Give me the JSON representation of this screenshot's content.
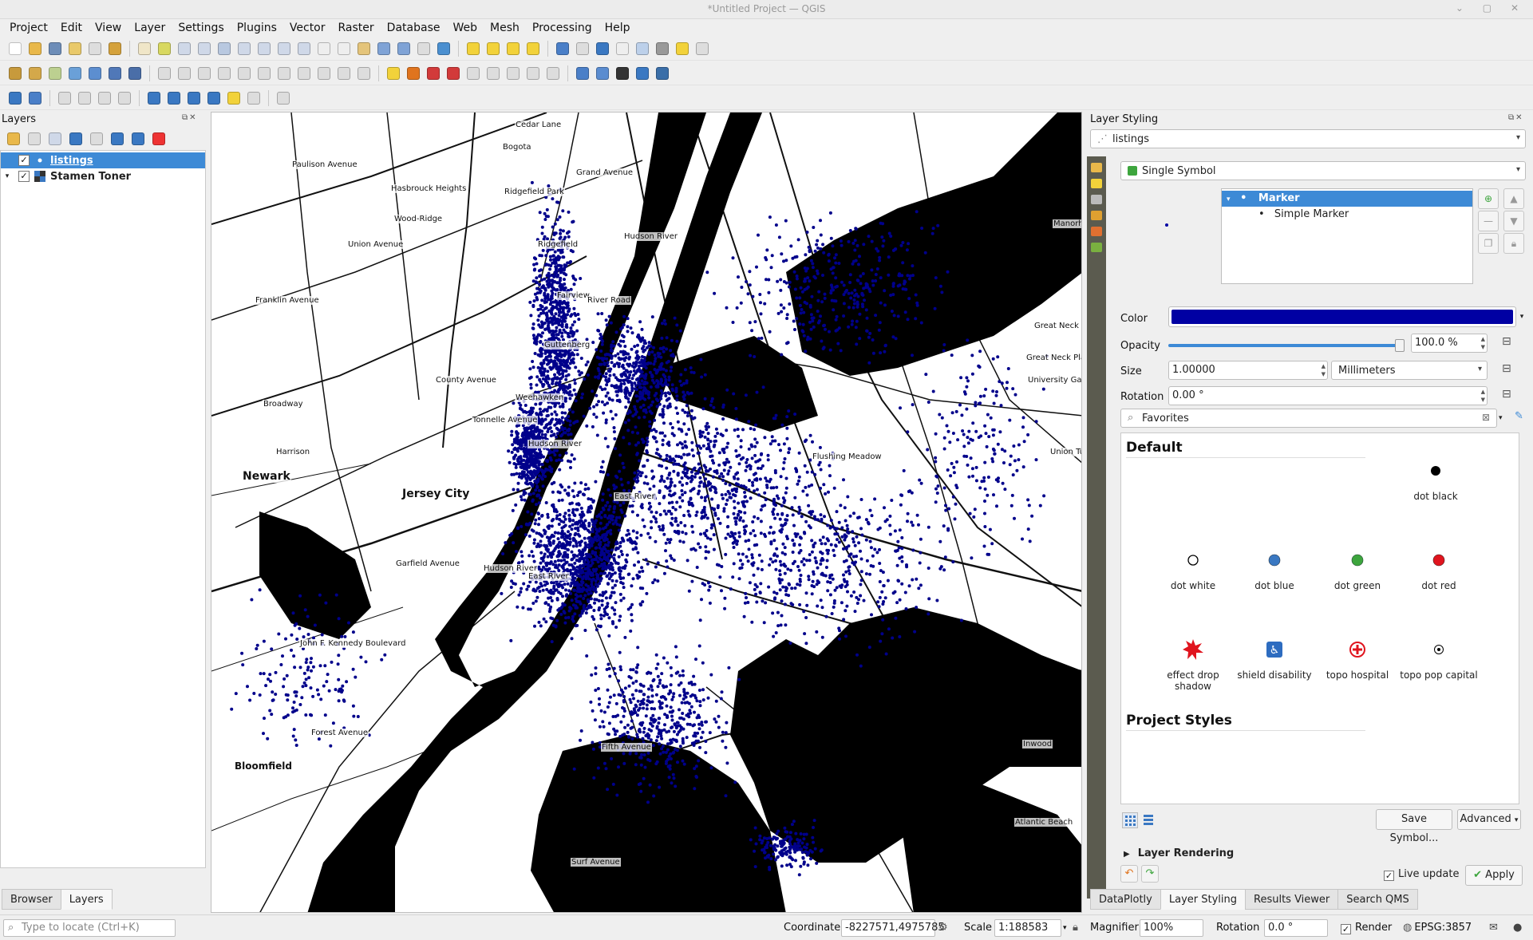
{
  "window": {
    "title": "*Untitled Project — QGIS",
    "controls": "⌄ ▢ ✕"
  },
  "menu": [
    "Project",
    "Edit",
    "View",
    "Layer",
    "Settings",
    "Plugins",
    "Vector",
    "Raster",
    "Database",
    "Web",
    "Mesh",
    "Processing",
    "Help"
  ],
  "layers_panel": {
    "title": "Layers",
    "layers": [
      {
        "name": "listings",
        "checked": true,
        "selected": true,
        "icon": "point-layer-icon"
      },
      {
        "name": "Stamen Toner",
        "checked": true,
        "selected": false,
        "icon": "raster-tile-icon"
      }
    ],
    "tabs": [
      "Browser",
      "Layers"
    ],
    "active_tab": "Layers"
  },
  "map": {
    "point_color": "#00008b",
    "labels": {
      "newark": "Newark",
      "jersey_city": "Jersey City",
      "harrison": "Harrison",
      "weehawken": "Weehawken",
      "guttenberg": "Guttenberg",
      "fairview": "Fairview",
      "ridgefield": "Ridgefield",
      "ridgefield_park": "Ridgefield Park",
      "bogota": "Bogota",
      "hasbrouck_heights": "Hasbrouck Heights",
      "wood_ridge": "Wood-Ridge",
      "cedar_lane": "Cedar Lane",
      "hudson_river_1": "Hudson River",
      "hudson_river_2": "Hudson River",
      "hudson_river_3": "Hudson River",
      "east_river_1": "East River",
      "east_river_2": "East River",
      "bloomfield": "Bloomfield",
      "great_neck": "Great Neck",
      "great_neck_plaza": "Great Neck Plaz",
      "university_gardens": "University Gar",
      "manorhaven": "Manorh",
      "inwood": "Inwood",
      "atlantic_beach": "Atlantic Beach",
      "flushing_meadows": "Flushing Meadow",
      "forest_avenue": "Forest Avenue",
      "surf_avenue": "Surf Avenue",
      "fifth_avenue": "Fifth Avenue",
      "john_kennedy_blvd": "John F. Kennedy Boulevard",
      "county_avenue": "County Avenue",
      "tonnelle_avenue": "Tonnelle Avenue",
      "river_road": "River Road",
      "grand_avenue": "Grand Avenue",
      "paulison_avenue": "Paulison Avenue",
      "franklin_avenue": "Franklin Avenue",
      "union_avenue": "Union Avenue",
      "broadway": "Broadway",
      "garfield_avenue": "Garfield Avenue",
      "union_turnpike": "Union Tu"
    }
  },
  "styling": {
    "title": "Layer Styling",
    "layer": "listings",
    "renderer": "Single Symbol",
    "tree": {
      "root": "Marker",
      "child": "Simple Marker"
    },
    "color_label": "Color",
    "color_value": "#0000a3",
    "opacity_label": "Opacity",
    "opacity_value": "100.0 %",
    "opacity_fraction": 1.0,
    "size_label": "Size",
    "size_value": "1.00000",
    "size_unit": "Millimeters",
    "rotation_label": "Rotation",
    "rotation_value": "0.00 °",
    "search_value": "Favorites",
    "library": {
      "default_heading": "Default",
      "project_heading": "Project Styles",
      "symbols": [
        {
          "label": "dot  black",
          "kind": "dot",
          "color": "#000000"
        },
        {
          "label": "dot  white",
          "kind": "ring",
          "color": "#ffffff"
        },
        {
          "label": "dot blue",
          "kind": "dot",
          "color": "#3a78c2"
        },
        {
          "label": "dot green",
          "kind": "dot",
          "color": "#3da53d"
        },
        {
          "label": "dot red",
          "kind": "dot",
          "color": "#e0141e"
        },
        {
          "label": "effect drop shadow",
          "kind": "star",
          "color": "#e0141e"
        },
        {
          "label": "shield disability",
          "kind": "shield",
          "color": "#2d6cc0"
        },
        {
          "label": "topo hospital",
          "kind": "hospital",
          "color": "#e0141e"
        },
        {
          "label": "topo pop capital",
          "kind": "capital",
          "color": "#000000"
        }
      ]
    },
    "save_symbol": "Save Symbol...",
    "advanced": "Advanced",
    "layer_rendering": "Layer Rendering",
    "live_update": "Live update",
    "apply": "Apply",
    "tabs": [
      "DataPlotly",
      "Layer Styling",
      "Results Viewer",
      "Search QMS"
    ],
    "active_tab": "Layer Styling"
  },
  "status": {
    "locator_placeholder": "Type to locate (Ctrl+K)",
    "coordinate_label": "Coordinate",
    "coordinate_value": "-8227571,4975785",
    "scale_label": "Scale",
    "scale_value": "1:188583",
    "magnifier_label": "Magnifier",
    "magnifier_value": "100%",
    "rotation_label": "Rotation",
    "rotation_value": "0.0 °",
    "render_label": "Render",
    "crs": "EPSG:3857"
  }
}
